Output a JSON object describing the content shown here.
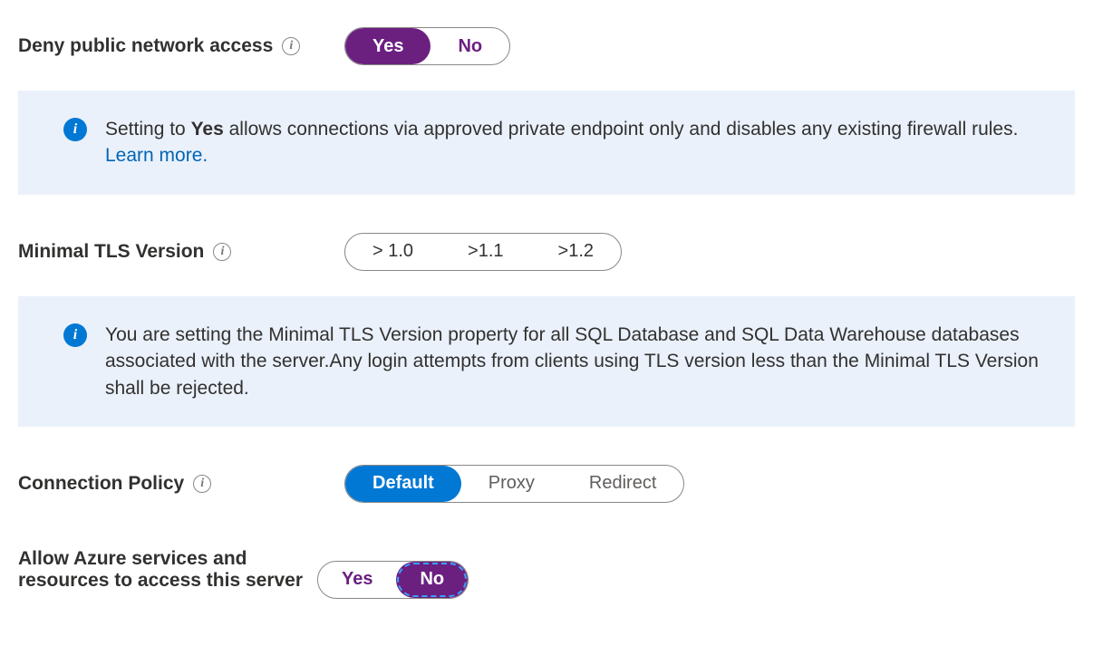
{
  "denyPublic": {
    "label": "Deny public network access",
    "options": {
      "yes": "Yes",
      "no": "No"
    }
  },
  "infoDeny": {
    "prefix": "Setting to ",
    "bold": "Yes",
    "suffix": " allows connections via approved private endpoint only and disables any existing firewall rules. ",
    "link": "Learn more."
  },
  "tls": {
    "label": "Minimal TLS Version",
    "options": {
      "v10": "> 1.0",
      "v11": ">1.1",
      "v12": ">1.2"
    }
  },
  "infoTls": {
    "text": "You are setting the Minimal TLS Version property for all SQL Database and SQL Data Warehouse databases associated with the server.Any login attempts from clients using TLS version less than the Minimal TLS Version shall be rejected."
  },
  "connPolicy": {
    "label": "Connection Policy",
    "options": {
      "default": "Default",
      "proxy": "Proxy",
      "redirect": "Redirect"
    }
  },
  "allowAzure": {
    "label": "Allow Azure services and resources to access this server",
    "options": {
      "yes": "Yes",
      "no": "No"
    }
  }
}
